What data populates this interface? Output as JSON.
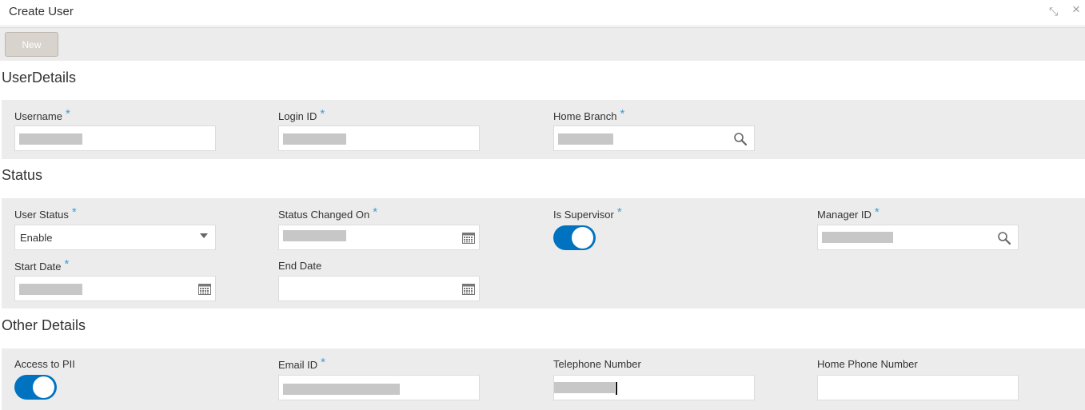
{
  "window": {
    "title": "Create User",
    "minimize_glyph": "⤡",
    "close_glyph": "×"
  },
  "toolbar": {
    "new_label": "New"
  },
  "sections": {
    "user_details": {
      "title": "UserDetails",
      "username": {
        "label": "Username",
        "required": "*"
      },
      "login_id": {
        "label": "Login ID",
        "required": "*"
      },
      "home_branch": {
        "label": "Home Branch",
        "required": "*",
        "icon": "search-icon"
      }
    },
    "status": {
      "title": "Status",
      "user_status": {
        "label": "User Status",
        "required": "*",
        "value": "Enable"
      },
      "status_changed_on": {
        "label": "Status Changed On",
        "required": "*",
        "icon": "calendar-icon"
      },
      "is_supervisor": {
        "label": "Is Supervisor",
        "required": "*",
        "on": true
      },
      "manager_id": {
        "label": "Manager ID",
        "required": "*",
        "icon": "search-icon"
      },
      "start_date": {
        "label": "Start Date",
        "required": "*",
        "icon": "calendar-icon"
      },
      "end_date": {
        "label": "End Date",
        "icon": "calendar-icon"
      }
    },
    "other_details": {
      "title": "Other Details",
      "access_to_pii": {
        "label": "Access to PII",
        "on": true
      },
      "email_id": {
        "label": "Email ID",
        "required": "*"
      },
      "telephone_number": {
        "label": "Telephone Number"
      },
      "home_phone_number": {
        "label": "Home Phone Number"
      }
    }
  },
  "colors": {
    "accent": "#0073c0",
    "required_star": "#3aa0d8",
    "panel_bg": "#ececec",
    "redacted": "#c7c7c7"
  }
}
